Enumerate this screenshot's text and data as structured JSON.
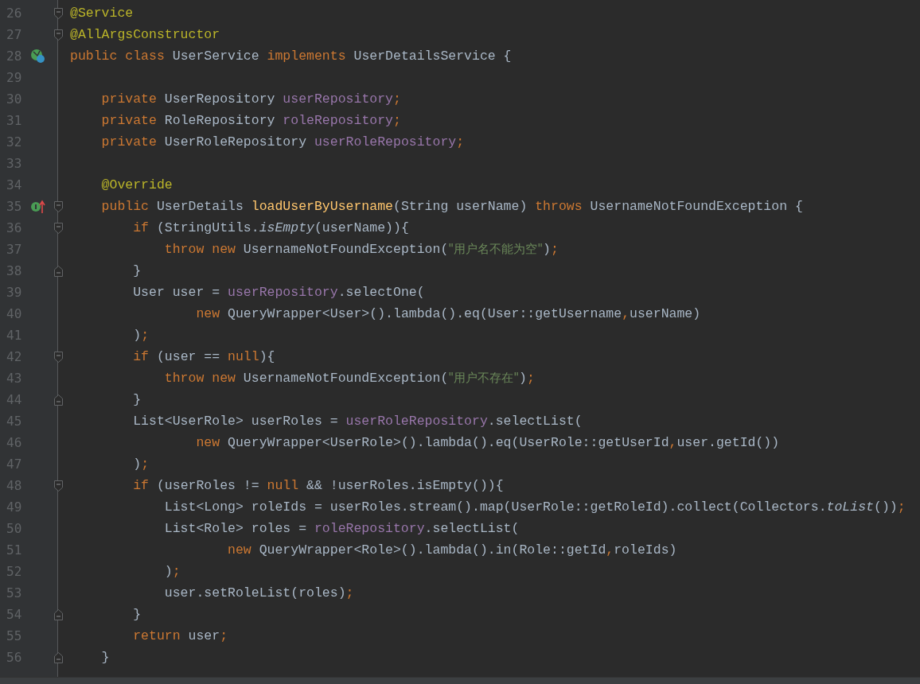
{
  "editor": {
    "lines": [
      {
        "number": "26",
        "fold": {
          "kind": "start"
        },
        "tokens": [
          {
            "kind": "annotation",
            "text": "@Service"
          }
        ]
      },
      {
        "number": "27",
        "fold": {
          "kind": "start"
        },
        "tokens": [
          {
            "kind": "annotation",
            "text": "@AllArgsConstructor"
          }
        ]
      },
      {
        "number": "28",
        "gutter_icon": {
          "kind": "implemented"
        },
        "tokens": [
          {
            "kind": "keyword",
            "text": "public class "
          },
          {
            "kind": "plain",
            "text": "UserService "
          },
          {
            "kind": "keyword",
            "text": "implements "
          },
          {
            "kind": "plain",
            "text": "UserDetailsService {"
          }
        ]
      },
      {
        "number": "29"
      },
      {
        "number": "30",
        "tokens": [
          {
            "kind": "keyword",
            "text": "    private "
          },
          {
            "kind": "plain",
            "text": "UserRepository "
          },
          {
            "kind": "field",
            "text": "userRepository"
          },
          {
            "kind": "keyword",
            "text": ";"
          }
        ]
      },
      {
        "number": "31",
        "tokens": [
          {
            "kind": "keyword",
            "text": "    private "
          },
          {
            "kind": "plain",
            "text": "RoleRepository "
          },
          {
            "kind": "field",
            "text": "roleRepository"
          },
          {
            "kind": "keyword",
            "text": ";"
          }
        ]
      },
      {
        "number": "32",
        "tokens": [
          {
            "kind": "keyword",
            "text": "    private "
          },
          {
            "kind": "plain",
            "text": "UserRoleRepository "
          },
          {
            "kind": "field",
            "text": "userRoleRepository"
          },
          {
            "kind": "keyword",
            "text": ";"
          }
        ]
      },
      {
        "number": "33"
      },
      {
        "number": "34",
        "tokens": [
          {
            "kind": "annotation",
            "text": "    @Override"
          }
        ]
      },
      {
        "number": "35",
        "gutter_icon": {
          "kind": "overrides"
        },
        "fold": {
          "kind": "start"
        },
        "tokens": [
          {
            "kind": "keyword",
            "text": "    public "
          },
          {
            "kind": "plain",
            "text": "UserDetails "
          },
          {
            "kind": "method",
            "text": "loadUserByUsername"
          },
          {
            "kind": "plain",
            "text": "(String userName) "
          },
          {
            "kind": "keyword",
            "text": "throws "
          },
          {
            "kind": "plain",
            "text": "UsernameNotFoundException {"
          }
        ]
      },
      {
        "number": "36",
        "fold": {
          "kind": "start"
        },
        "tokens": [
          {
            "kind": "keyword",
            "text": "        if "
          },
          {
            "kind": "plain",
            "text": "(StringUtils."
          },
          {
            "kind": "static",
            "text": "isEmpty"
          },
          {
            "kind": "plain",
            "text": "(userName)){"
          }
        ]
      },
      {
        "number": "37",
        "tokens": [
          {
            "kind": "keyword",
            "text": "            throw new "
          },
          {
            "kind": "plain",
            "text": "UsernameNotFoundException("
          },
          {
            "kind": "string",
            "text": "\"用户名不能为空\""
          },
          {
            "kind": "plain",
            "text": ")"
          },
          {
            "kind": "keyword",
            "text": ";"
          }
        ]
      },
      {
        "number": "38",
        "fold": {
          "kind": "end"
        },
        "tokens": [
          {
            "kind": "plain",
            "text": "        }"
          }
        ]
      },
      {
        "number": "39",
        "tokens": [
          {
            "kind": "plain",
            "text": "        User user = "
          },
          {
            "kind": "field",
            "text": "userRepository"
          },
          {
            "kind": "plain",
            "text": ".selectOne("
          }
        ]
      },
      {
        "number": "40",
        "tokens": [
          {
            "kind": "keyword",
            "text": "                new "
          },
          {
            "kind": "plain",
            "text": "QueryWrapper<User>().lambda().eq(User::getUsername"
          },
          {
            "kind": "keyword",
            "text": ","
          },
          {
            "kind": "plain",
            "text": "userName)"
          }
        ]
      },
      {
        "number": "41",
        "tokens": [
          {
            "kind": "plain",
            "text": "        )"
          },
          {
            "kind": "keyword",
            "text": ";"
          }
        ]
      },
      {
        "number": "42",
        "fold": {
          "kind": "start"
        },
        "tokens": [
          {
            "kind": "keyword",
            "text": "        if "
          },
          {
            "kind": "plain",
            "text": "(user == "
          },
          {
            "kind": "keyword",
            "text": "null"
          },
          {
            "kind": "plain",
            "text": "){"
          }
        ]
      },
      {
        "number": "43",
        "tokens": [
          {
            "kind": "keyword",
            "text": "            throw new "
          },
          {
            "kind": "plain",
            "text": "UsernameNotFoundException("
          },
          {
            "kind": "string",
            "text": "\"用户不存在\""
          },
          {
            "kind": "plain",
            "text": ")"
          },
          {
            "kind": "keyword",
            "text": ";"
          }
        ]
      },
      {
        "number": "44",
        "fold": {
          "kind": "end"
        },
        "tokens": [
          {
            "kind": "plain",
            "text": "        }"
          }
        ]
      },
      {
        "number": "45",
        "tokens": [
          {
            "kind": "plain",
            "text": "        List<UserRole> userRoles = "
          },
          {
            "kind": "field",
            "text": "userRoleRepository"
          },
          {
            "kind": "plain",
            "text": ".selectList("
          }
        ]
      },
      {
        "number": "46",
        "tokens": [
          {
            "kind": "keyword",
            "text": "                new "
          },
          {
            "kind": "plain",
            "text": "QueryWrapper<UserRole>().lambda().eq(UserRole::getUserId"
          },
          {
            "kind": "keyword",
            "text": ","
          },
          {
            "kind": "plain",
            "text": "user.getId())"
          }
        ]
      },
      {
        "number": "47",
        "tokens": [
          {
            "kind": "plain",
            "text": "        )"
          },
          {
            "kind": "keyword",
            "text": ";"
          }
        ]
      },
      {
        "number": "48",
        "fold": {
          "kind": "start"
        },
        "tokens": [
          {
            "kind": "keyword",
            "text": "        if "
          },
          {
            "kind": "plain",
            "text": "(userRoles != "
          },
          {
            "kind": "keyword",
            "text": "null "
          },
          {
            "kind": "plain",
            "text": "&& !userRoles.isEmpty()){"
          }
        ]
      },
      {
        "number": "49",
        "tokens": [
          {
            "kind": "plain",
            "text": "            List<Long> roleIds = userRoles.stream().map(UserRole::getRoleId).collect(Collectors."
          },
          {
            "kind": "static",
            "text": "toList"
          },
          {
            "kind": "plain",
            "text": "())"
          },
          {
            "kind": "keyword",
            "text": ";"
          }
        ]
      },
      {
        "number": "50",
        "tokens": [
          {
            "kind": "plain",
            "text": "            List<Role> roles = "
          },
          {
            "kind": "field",
            "text": "roleRepository"
          },
          {
            "kind": "plain",
            "text": ".selectList("
          }
        ]
      },
      {
        "number": "51",
        "tokens": [
          {
            "kind": "keyword",
            "text": "                    new "
          },
          {
            "kind": "plain",
            "text": "QueryWrapper<Role>().lambda().in(Role::getId"
          },
          {
            "kind": "keyword",
            "text": ","
          },
          {
            "kind": "plain",
            "text": "roleIds)"
          }
        ]
      },
      {
        "number": "52",
        "tokens": [
          {
            "kind": "plain",
            "text": "            )"
          },
          {
            "kind": "keyword",
            "text": ";"
          }
        ]
      },
      {
        "number": "53",
        "tokens": [
          {
            "kind": "plain",
            "text": "            user.setRoleList(roles)"
          },
          {
            "kind": "keyword",
            "text": ";"
          }
        ]
      },
      {
        "number": "54",
        "fold": {
          "kind": "end"
        },
        "tokens": [
          {
            "kind": "plain",
            "text": "        }"
          }
        ]
      },
      {
        "number": "55",
        "tokens": [
          {
            "kind": "keyword",
            "text": "        return "
          },
          {
            "kind": "plain",
            "text": "user"
          },
          {
            "kind": "keyword",
            "text": ";"
          }
        ]
      },
      {
        "number": "56",
        "fold": {
          "kind": "end"
        },
        "tokens": [
          {
            "kind": "plain",
            "text": "    }"
          }
        ]
      }
    ]
  }
}
